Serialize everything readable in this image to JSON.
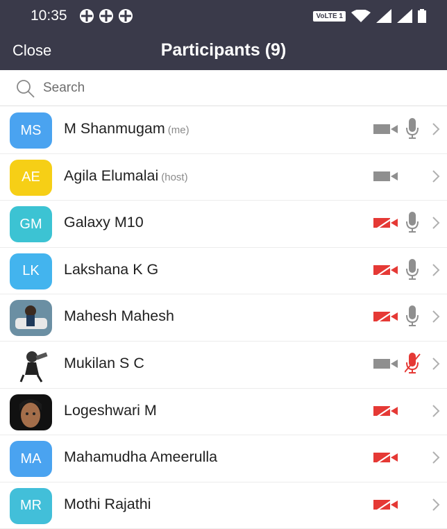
{
  "status_bar": {
    "time": "10:35",
    "network_badge": "VoLTE 1"
  },
  "header": {
    "close_label": "Close",
    "title": "Participants (9)"
  },
  "search": {
    "placeholder": "Search"
  },
  "colors": {
    "bar": "#3a3a4a",
    "muted_red": "#e53935",
    "icon_gray": "#8f8f8f"
  },
  "participants": [
    {
      "initials": "MS",
      "name": "M Shanmugam",
      "tag": "(me)",
      "avatar_color": "#4aa3f0",
      "video_on": true,
      "mic": "on"
    },
    {
      "initials": "AE",
      "name": "Agila Elumalai",
      "tag": "(host)",
      "avatar_color": "#f6cf16",
      "video_on": true,
      "mic": "none"
    },
    {
      "initials": "GM",
      "name": "Galaxy M10",
      "tag": "",
      "avatar_color": "#3cc3d3",
      "video_on": false,
      "mic": "on"
    },
    {
      "initials": "LK",
      "name": "Lakshana K G",
      "tag": "",
      "avatar_color": "#43b4ee",
      "video_on": false,
      "mic": "on"
    },
    {
      "initials": "",
      "name": "Mahesh Mahesh",
      "tag": "",
      "avatar_color": "photo",
      "video_on": false,
      "mic": "on"
    },
    {
      "initials": "",
      "name": "Mukilan S C",
      "tag": "",
      "avatar_color": "photo",
      "video_on": true,
      "mic": "muted"
    },
    {
      "initials": "",
      "name": "Logeshwari M",
      "tag": "",
      "avatar_color": "photo",
      "video_on": false,
      "mic": "none"
    },
    {
      "initials": "MA",
      "name": "Mahamudha Ameerulla",
      "tag": "",
      "avatar_color": "#4aa3f0",
      "video_on": false,
      "mic": "none"
    },
    {
      "initials": "MR",
      "name": "Mothi Rajathi",
      "tag": "",
      "avatar_color": "#42bfd9",
      "video_on": false,
      "mic": "none"
    }
  ]
}
